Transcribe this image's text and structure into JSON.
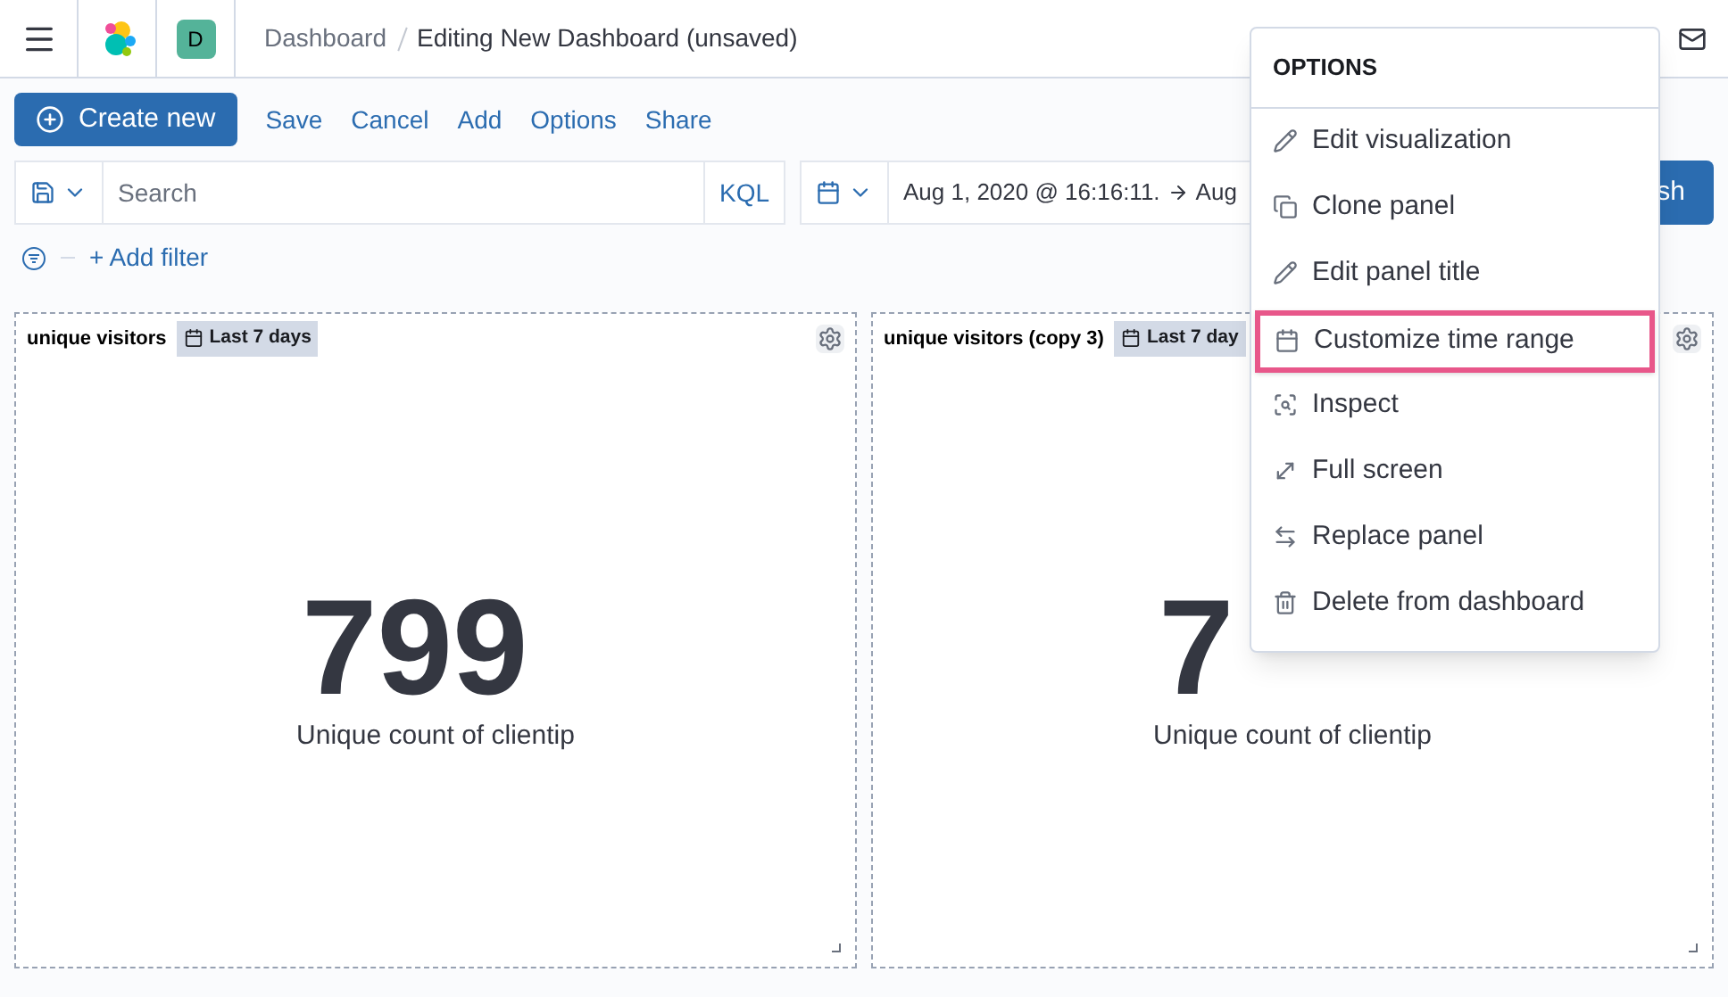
{
  "header": {
    "avatar": "D",
    "breadcrumbs": [
      {
        "label": "Dashboard",
        "current": false
      },
      {
        "label": "Editing New Dashboard (unsaved)",
        "current": true
      }
    ]
  },
  "toolbar": {
    "primary": "Create new",
    "links": [
      "Save",
      "Cancel",
      "Add",
      "Options",
      "Share"
    ]
  },
  "query": {
    "placeholder": "Search",
    "language": "KQL",
    "start": "Aug 1, 2020 @ 16:16:11.",
    "end": "Aug",
    "refresh": "sh"
  },
  "filter": {
    "add": "+ Add filter"
  },
  "panels": [
    {
      "title": "unique visitors",
      "time": "Last 7 days",
      "value": "799",
      "caption": "Unique count of clientip"
    },
    {
      "title": "unique visitors (copy 3)",
      "time": "Last 7 day",
      "value": "7",
      "caption": "Unique count of clientip"
    }
  ],
  "menu": {
    "title": "OPTIONS",
    "items": [
      {
        "kind": "pencil",
        "label": "Edit visualization",
        "selected": false
      },
      {
        "kind": "copy",
        "label": "Clone panel",
        "selected": false
      },
      {
        "kind": "pencil",
        "label": "Edit panel title",
        "selected": false
      },
      {
        "kind": "calendar",
        "label": "Customize time range",
        "selected": true
      },
      {
        "kind": "inspect",
        "label": "Inspect",
        "selected": false
      },
      {
        "kind": "expand",
        "label": "Full screen",
        "selected": false
      },
      {
        "kind": "swap",
        "label": "Replace panel",
        "selected": false
      },
      {
        "kind": "trash",
        "label": "Delete from dashboard",
        "selected": false
      }
    ]
  }
}
